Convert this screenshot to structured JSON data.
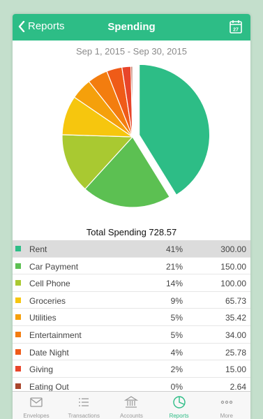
{
  "nav": {
    "back_label": "Reports",
    "title": "Spending",
    "calendar_day": "27"
  },
  "date_range": "Sep 1, 2015 - Sep 30, 2015",
  "total_label": "Total Spending 728.57",
  "categories": [
    {
      "name": "Rent",
      "percent": "41%",
      "amount": "300.00",
      "value": 300.0,
      "color": "#2dbd86"
    },
    {
      "name": "Car Payment",
      "percent": "21%",
      "amount": "150.00",
      "value": 150.0,
      "color": "#5cc052"
    },
    {
      "name": "Cell Phone",
      "percent": "14%",
      "amount": "100.00",
      "value": 100.0,
      "color": "#a9c931"
    },
    {
      "name": "Groceries",
      "percent": "9%",
      "amount": "65.73",
      "value": 65.73,
      "color": "#f6c60e"
    },
    {
      "name": "Utilities",
      "percent": "5%",
      "amount": "35.42",
      "value": 35.42,
      "color": "#f5a00b"
    },
    {
      "name": "Entertainment",
      "percent": "5%",
      "amount": "34.00",
      "value": 34.0,
      "color": "#f37d0f"
    },
    {
      "name": "Date Night",
      "percent": "4%",
      "amount": "25.78",
      "value": 25.78,
      "color": "#ef5b18"
    },
    {
      "name": "Giving",
      "percent": "2%",
      "amount": "15.00",
      "value": 15.0,
      "color": "#e8452a"
    },
    {
      "name": "Eating Out",
      "percent": "0%",
      "amount": "2.64",
      "value": 2.64,
      "color": "#a9472c"
    }
  ],
  "tabs": [
    {
      "label": "Envelopes",
      "icon": "envelope-icon"
    },
    {
      "label": "Transactions",
      "icon": "list-icon"
    },
    {
      "label": "Accounts",
      "icon": "bank-icon"
    },
    {
      "label": "Reports",
      "icon": "pie-chart-icon",
      "active": true
    },
    {
      "label": "More",
      "icon": "more-icon"
    }
  ],
  "chart_data": {
    "type": "pie",
    "categories": [
      "Rent",
      "Car Payment",
      "Cell Phone",
      "Groceries",
      "Utilities",
      "Entertainment",
      "Date Night",
      "Giving",
      "Eating Out"
    ],
    "values": [
      300.0,
      150.0,
      100.0,
      65.73,
      35.42,
      34.0,
      25.78,
      15.0,
      2.64
    ],
    "exploded": "Rent"
  }
}
